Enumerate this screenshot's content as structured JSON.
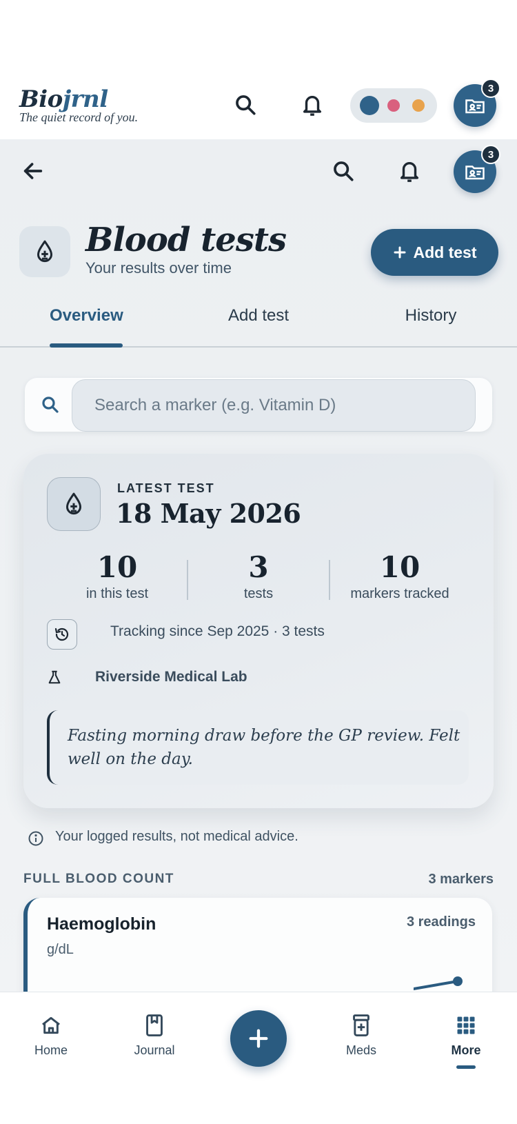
{
  "app_header": {
    "brand_prefix": "Bio",
    "brand_accent": "jrnl",
    "tagline": "The quiet record of you.",
    "notification_badge": "3",
    "theme_dots": [
      "#2f6289",
      "#d9607e",
      "#e8a24c"
    ]
  },
  "subnav": {
    "profile_badge": "3"
  },
  "page": {
    "title": "Blood tests",
    "subtitle": "Your results over time",
    "add_button_label": "Add test"
  },
  "tabs": [
    {
      "label": "Overview",
      "active": true
    },
    {
      "label": "Add test",
      "active": false
    },
    {
      "label": "History",
      "active": false
    }
  ],
  "search": {
    "placeholder": "Search a marker (e.g. Vitamin D)"
  },
  "latest_test": {
    "label": "LATEST TEST",
    "date": "18 May 2026",
    "stats": [
      {
        "value": "10",
        "label": "in this test"
      },
      {
        "value": "3",
        "label": "tests"
      },
      {
        "value": "10",
        "label": "markers tracked"
      }
    ],
    "tracking_text": "Tracking since Sep 2025 · 3 tests",
    "lab": "Riverside Medical Lab",
    "note": "Fasting morning draw before the GP review. Felt well on the day."
  },
  "disclaimer": "Your logged results, not medical advice.",
  "section": {
    "title": "FULL BLOOD COUNT",
    "count": "3 markers"
  },
  "marker": {
    "name": "Haemoglobin",
    "unit": "g/dL",
    "readings": "3 readings"
  },
  "bottom_nav": {
    "items": [
      {
        "label": "Home",
        "icon": "home-icon"
      },
      {
        "label": "Journal",
        "icon": "book-icon"
      },
      {
        "label": "Meds",
        "icon": "pill-bottle-icon"
      },
      {
        "label": "More",
        "icon": "grid-icon",
        "active": true
      }
    ]
  },
  "colors": {
    "primary": "#2a5b80",
    "ink": "#18232e",
    "page_bg": "#eceff2"
  }
}
